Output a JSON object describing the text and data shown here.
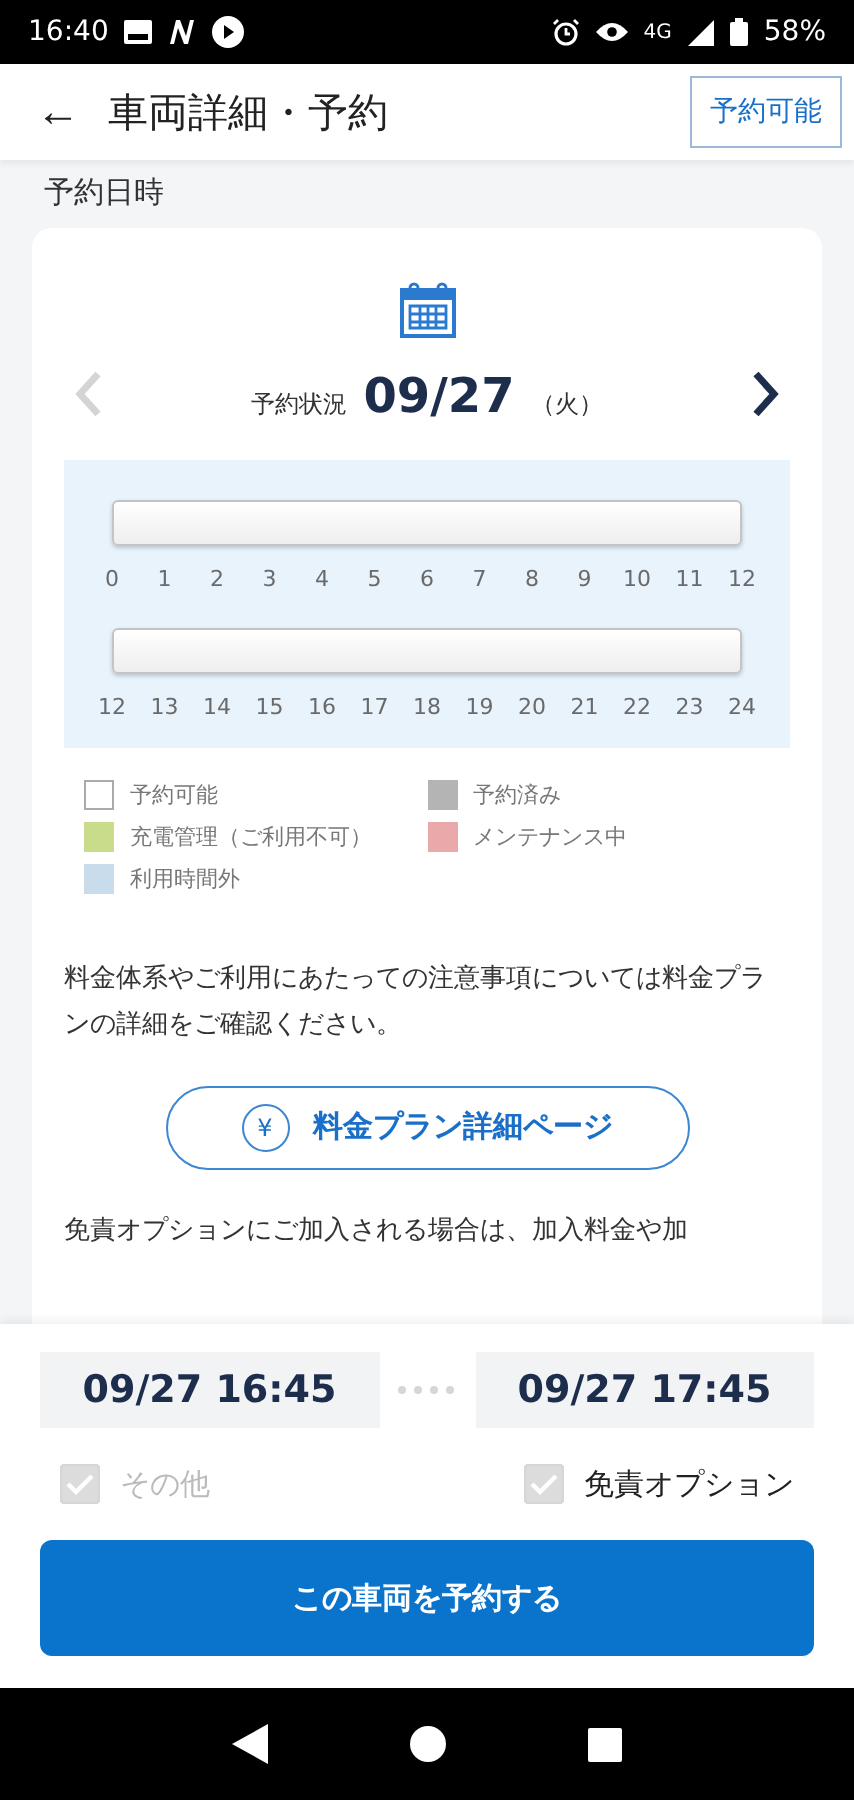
{
  "status_bar": {
    "time": "16:40",
    "network": "4G",
    "battery": "58%"
  },
  "header": {
    "back": "←",
    "title": "車両詳細・予約",
    "status_button": "予約可能"
  },
  "section_label": "予約日時",
  "schedule": {
    "label": "予約状況",
    "date": "09/27",
    "weekday": "（火）",
    "prev_disabled": true,
    "next_disabled": false,
    "rows": [
      {
        "ticks": [
          "0",
          "1",
          "2",
          "3",
          "4",
          "5",
          "6",
          "7",
          "8",
          "9",
          "10",
          "11",
          "12"
        ]
      },
      {
        "ticks": [
          "12",
          "13",
          "14",
          "15",
          "16",
          "17",
          "18",
          "19",
          "20",
          "21",
          "22",
          "23",
          "24"
        ]
      }
    ]
  },
  "legend": [
    {
      "label": "予約可能",
      "color": "#ffffff"
    },
    {
      "label": "予約済み",
      "color": "#b4b4b4"
    },
    {
      "label": "充電管理（ご利用不可）",
      "color": "#c8dc8c"
    },
    {
      "label": "メンテナンス中",
      "color": "#eaa8aa"
    },
    {
      "label": "利用時間外",
      "color": "#c8dcec"
    }
  ],
  "notice": "料金体系やご利用にあたっての注意事項については料金プランの詳細をご確認ください。",
  "plan_button": {
    "icon": "¥",
    "label": "料金プラン詳細ページ"
  },
  "insurance_notice": "免責オプションにご加入される場合は、加入料金や加",
  "booking": {
    "start": "09/27 16:45",
    "end": "09/27 17:45",
    "options": [
      {
        "label": "その他",
        "checked": true,
        "disabled": true
      },
      {
        "label": "免責オプション",
        "checked": true,
        "disabled": false
      }
    ],
    "submit": "この車両を予約する"
  }
}
